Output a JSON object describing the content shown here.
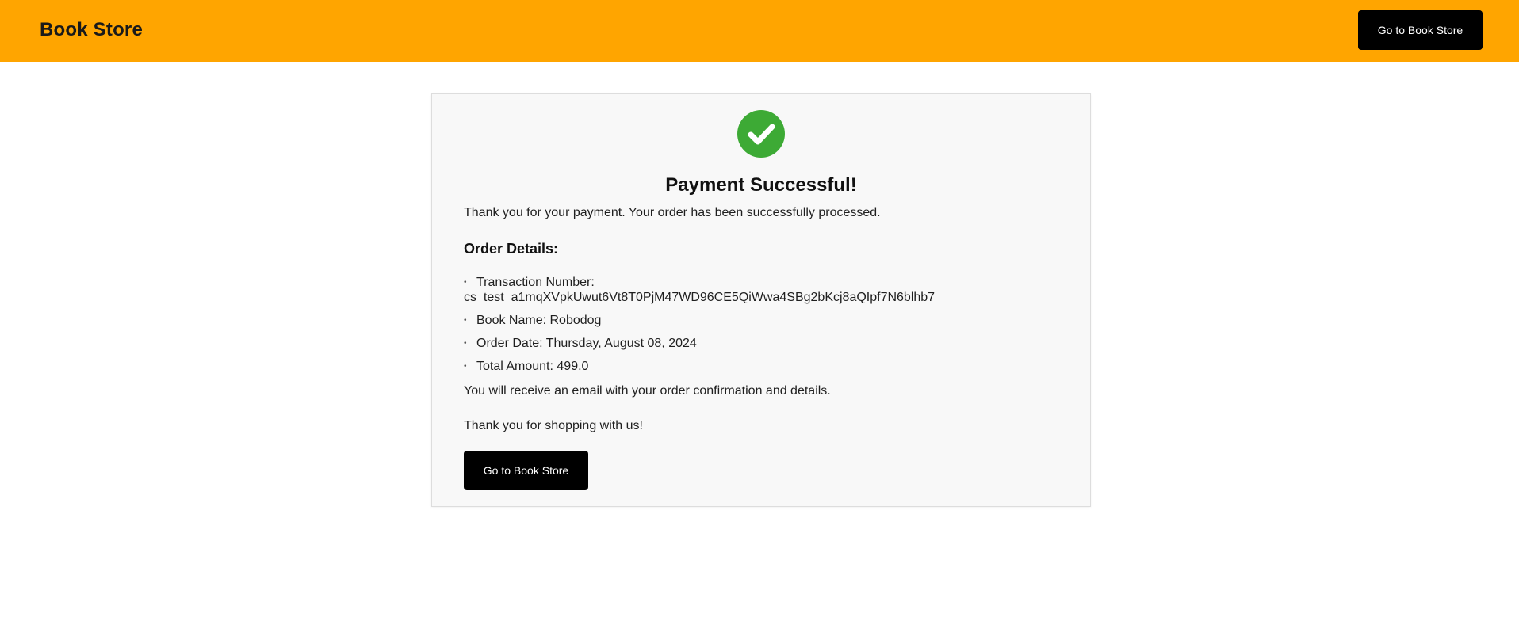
{
  "header": {
    "brand": "Book Store",
    "button_label": "Go to Book Store",
    "background": "#ffa500"
  },
  "card": {
    "status_icon": "check-circle-icon",
    "status_color": "#3daa35",
    "title": "Payment Successful!",
    "message": "Thank you for your payment. Your order has been successfully processed.",
    "details_heading": "Order Details:",
    "details": {
      "transaction_label": "Transaction Number:",
      "transaction_value": "cs_test_a1mqXVpkUwut6Vt8T0PjM47WD96CE5QiWwa4SBg2bKcj8aQIpf7N6blhb7",
      "book_name": "Book Name: Robodog",
      "order_date": "Order Date: Thursday, August 08, 2024",
      "total_amount": "Total Amount: 499.0"
    },
    "email_note": "You will receive an email with your order confirmation and details.",
    "thanks": "Thank you for shopping with us!",
    "button_label": "Go to Book Store"
  }
}
